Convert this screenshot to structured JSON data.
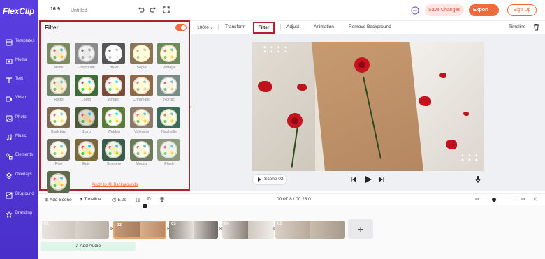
{
  "app": {
    "logo_first": "F",
    "logo_rest": "lexClip"
  },
  "sidebar": {
    "items": [
      {
        "label": "Templates",
        "icon": "templates-icon"
      },
      {
        "label": "Media",
        "icon": "media-icon"
      },
      {
        "label": "Text",
        "icon": "text-icon"
      },
      {
        "label": "Video",
        "icon": "video-icon"
      },
      {
        "label": "Photo",
        "icon": "photo-icon"
      },
      {
        "label": "Music",
        "icon": "music-icon"
      },
      {
        "label": "Elements",
        "icon": "elements-icon"
      },
      {
        "label": "Overlays",
        "icon": "overlays-icon"
      },
      {
        "label": "BKground",
        "icon": "background-icon"
      },
      {
        "label": "Branding",
        "icon": "branding-icon"
      }
    ]
  },
  "topbar": {
    "ratio": "16:9",
    "title_placeholder": "Untitled",
    "save_label": "Save Changes",
    "export_label": "Export →",
    "signup_label": "Sign Up"
  },
  "filter_panel": {
    "title": "Filter",
    "enabled": true,
    "filters": [
      {
        "label": "None",
        "tint": "none"
      },
      {
        "label": "Greyscale",
        "tint": "grey"
      },
      {
        "label": "B&W",
        "tint": "bw"
      },
      {
        "label": "Sepia",
        "tint": "sepia"
      },
      {
        "label": "Vintage",
        "tint": "vintage"
      },
      {
        "label": "Retro",
        "tint": "retro"
      },
      {
        "label": "Lomo",
        "tint": "lomo"
      },
      {
        "label": "Amaro",
        "tint": "amaro"
      },
      {
        "label": "Chromatic",
        "tint": "chromatic"
      },
      {
        "label": "Nordic",
        "tint": "nordic"
      },
      {
        "label": "Earlybird",
        "tint": "earlybird"
      },
      {
        "label": "Sutro",
        "tint": "sutro"
      },
      {
        "label": "Walden",
        "tint": "walden"
      },
      {
        "label": "Valencia",
        "tint": "valencia"
      },
      {
        "label": "Nashville",
        "tint": "nashville"
      },
      {
        "label": "Rise",
        "tint": "rise"
      },
      {
        "label": "Epic",
        "tint": "epic"
      },
      {
        "label": "Scenery",
        "tint": "scenery"
      },
      {
        "label": "Moody",
        "tint": "moody"
      },
      {
        "label": "Flash",
        "tint": "flash"
      },
      {
        "label": "",
        "tint": "extra"
      }
    ],
    "apply_all": "Apply to All Backgrounds"
  },
  "edit_toolbar": {
    "zoom": "100%",
    "transform": "Transform",
    "filter": "Filter",
    "adjust": "Adjust",
    "animation": "Animation",
    "remove_bg": "Remove Background",
    "timeline": "Timeline"
  },
  "player": {
    "scene_label": "Scene 02"
  },
  "timeline": {
    "add_scene": "Add Scene",
    "timeline_label": "Timeline",
    "duration": "5.0s",
    "timecode": "00:07.8 / 00:23.0",
    "add_audio": "Add Audio",
    "clips": [
      {
        "number": "01"
      },
      {
        "number": "02"
      },
      {
        "number": "03"
      },
      {
        "number": "04"
      },
      {
        "number": "05"
      }
    ]
  },
  "colors": {
    "accent": "#f26a3b",
    "sidebar": "#5b3ee0",
    "highlight_border": "#b3202c"
  }
}
